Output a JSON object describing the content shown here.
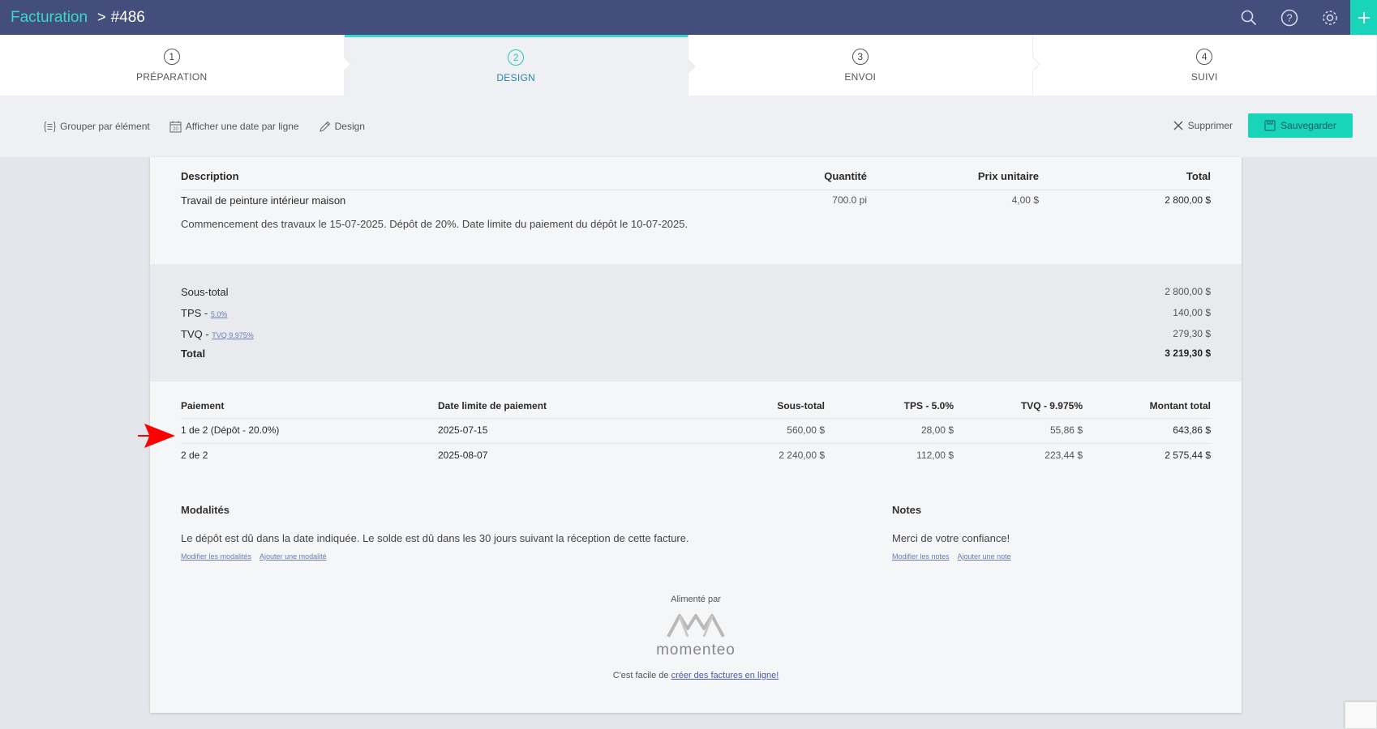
{
  "header": {
    "breadcrumb_root": "Facturation",
    "separator": ">",
    "current": "#486",
    "icons": [
      "search-icon",
      "help-icon",
      "settings-icon",
      "plus-icon"
    ],
    "accent_color": "#3bd8c6",
    "bar_color": "#434e7d"
  },
  "steps": [
    {
      "num": "1",
      "label": "PRÉPARATION",
      "active": false
    },
    {
      "num": "2",
      "label": "DESIGN",
      "active": true
    },
    {
      "num": "3",
      "label": "ENVOI",
      "active": false
    },
    {
      "num": "4",
      "label": "SUIVI",
      "active": false
    }
  ],
  "toolbar": {
    "group_label": "Grouper par élément",
    "date_label": "Afficher une date par ligne",
    "design_label": "Design",
    "delete_label": "Supprimer",
    "save_label": "Sauvegarder"
  },
  "items": {
    "headers": {
      "description": "Description",
      "quantity": "Quantité",
      "unit_price": "Prix unitaire",
      "total": "Total"
    },
    "rows": [
      {
        "description": "Travail de peinture intérieur maison",
        "quantity": "700.0 pi",
        "unit_price": "4,00 $",
        "total": "2 800,00 $"
      }
    ],
    "note": "Commencement des travaux le 15-07-2025. Dépôt de 20%. Date limite du paiement du dépôt le 10-07-2025."
  },
  "totals": {
    "subtotal_label": "Sous-total",
    "subtotal_value": "2 800,00 $",
    "tps_label": "TPS - ",
    "tps_link": "5.0%",
    "tps_value": "140,00 $",
    "tvq_label": "TVQ - ",
    "tvq_link": "TVQ 9.975%",
    "tvq_value": "279,30 $",
    "total_label": "Total",
    "total_value": "3 219,30 $"
  },
  "payments": {
    "headers": {
      "payment": "Paiement",
      "due": "Date limite de paiement",
      "subtotal": "Sous-total",
      "tps": "TPS - 5.0%",
      "tvq": "TVQ - 9.975%",
      "total": "Montant total"
    },
    "rows": [
      {
        "payment": "1 de 2 (Dépôt - 20.0%)",
        "due": "2025-07-15",
        "subtotal": "560,00 $",
        "tps": "28,00 $",
        "tvq": "55,86 $",
        "total": "643,86 $"
      },
      {
        "payment": "2 de 2",
        "due": "2025-08-07",
        "subtotal": "2 240,00 $",
        "tps": "112,00 $",
        "tvq": "223,44 $",
        "total": "2 575,44 $"
      }
    ]
  },
  "terms": {
    "title": "Modalités",
    "body": "Le dépôt est dû dans la date indiquée. Le solde est dû dans les 30 jours suivant la réception de cette facture.",
    "edit_link": "Modifier les modalités",
    "add_link": "Ajouter une modalité"
  },
  "notes": {
    "title": "Notes",
    "body": "Merci de votre confiance!",
    "edit_link": "Modifier les notes",
    "add_link": "Ajouter une note"
  },
  "footer": {
    "powered_label": "Alimenté par",
    "brand": "momenteo",
    "cta_prefix": "C'est facile de ",
    "cta_link": "créer des factures en ligne!"
  }
}
